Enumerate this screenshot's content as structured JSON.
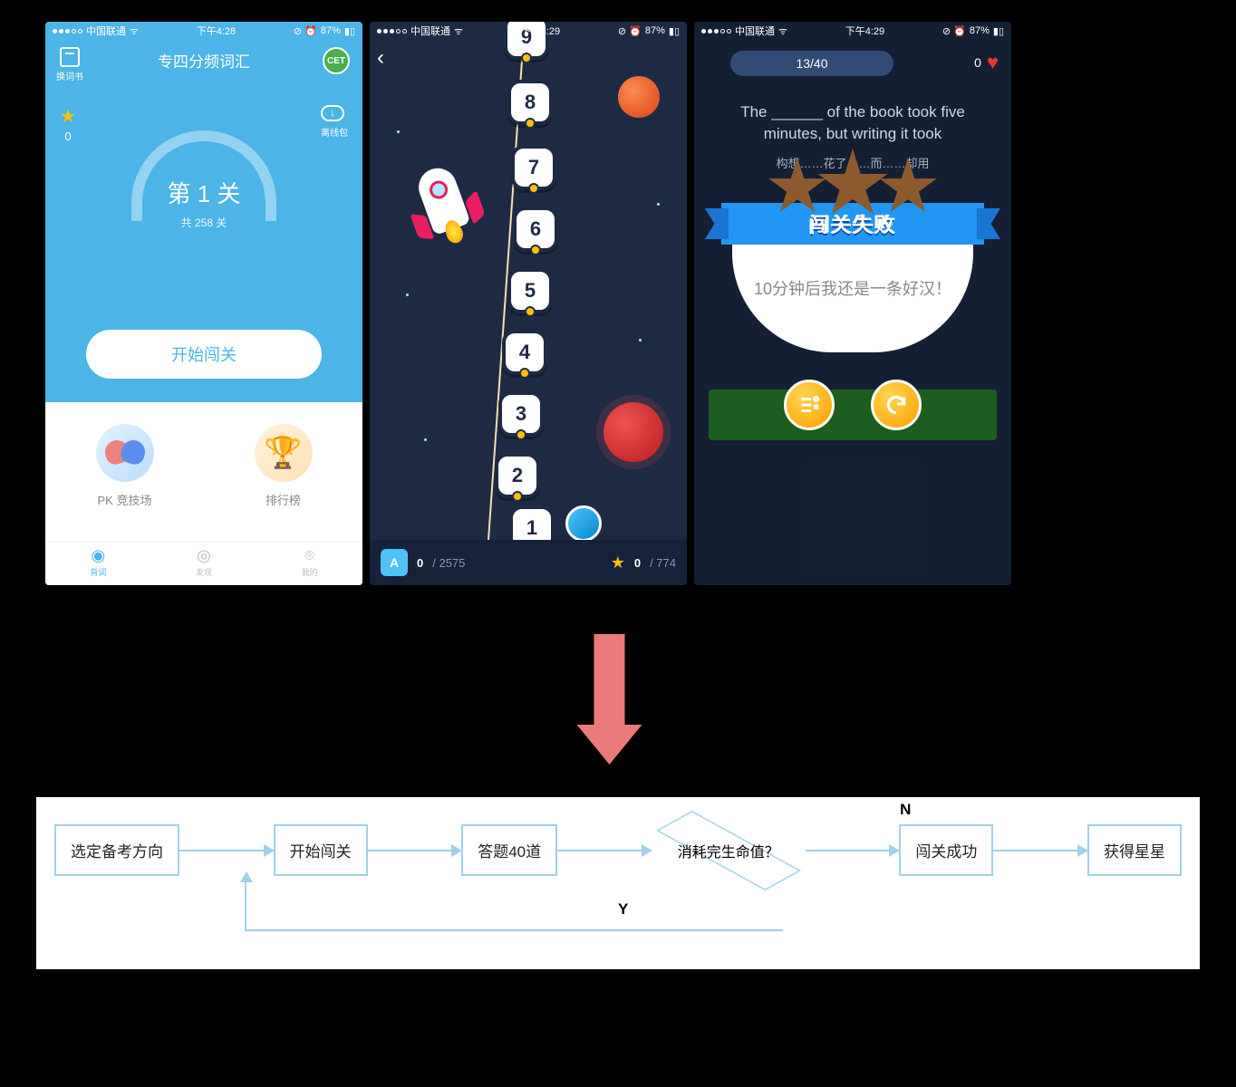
{
  "status": {
    "carrier": "中国联通",
    "time1": "下午4:28",
    "time2": "下午4:29",
    "time3": "下午4:29",
    "battery": "87%"
  },
  "phone1": {
    "title": "专四分频词汇",
    "book_btn": "换词书",
    "cet_badge": "CET",
    "star_count": "0",
    "cloud_btn": "离线包",
    "level": "第 1 关",
    "total": "共 258 关",
    "start": "开始闯关",
    "pk_label": "PK 竞技场",
    "rank_label": "排行榜",
    "tabs": [
      "背词",
      "发现",
      "我的"
    ]
  },
  "phone2": {
    "nodes": [
      "9",
      "8",
      "7",
      "6",
      "5",
      "4",
      "3",
      "2",
      "1"
    ],
    "bottom": {
      "left_val": "0",
      "left_total": "/ 2575",
      "right_val": "0",
      "right_total": "/ 774"
    },
    "book_icon": "A"
  },
  "phone3": {
    "progress": "13/40",
    "heart_count": "0",
    "question_en": "The ______ of the book took five minutes, but writing it took",
    "question_cn": "构想……花了……而……却用",
    "banner": "闯关失败",
    "message": "10分钟后我还是一条好汉！"
  },
  "flow": {
    "b1": "选定备考方向",
    "b2": "开始闯关",
    "b3": "答题40道",
    "d": "消耗完生命值？",
    "b4": "闯关成功",
    "b5": "获得星星",
    "n": "N",
    "y": "Y"
  }
}
